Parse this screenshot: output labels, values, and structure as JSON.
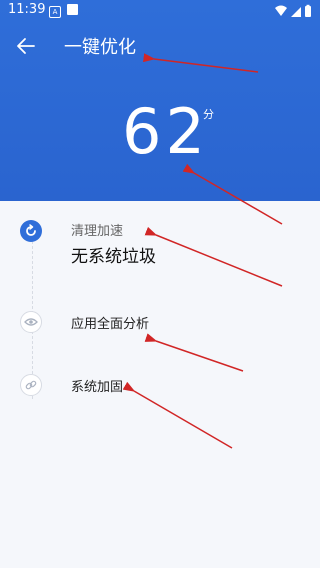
{
  "status_bar": {
    "time": "11:39",
    "a_icon": "A"
  },
  "header": {
    "title": "一键优化",
    "score": "62",
    "score_unit": "分"
  },
  "steps": [
    {
      "label": "清理加速",
      "status": "无系统垃圾",
      "icon": "refresh-icon",
      "active": true
    },
    {
      "label": "应用全面分析",
      "icon": "eye-icon",
      "active": false
    },
    {
      "label": "系统加固",
      "icon": "link-icon",
      "active": false
    }
  ],
  "colors": {
    "header_bg": "#2f6ed9",
    "page_bg": "#f5f7fb",
    "active_step": "#2f6ed9"
  }
}
